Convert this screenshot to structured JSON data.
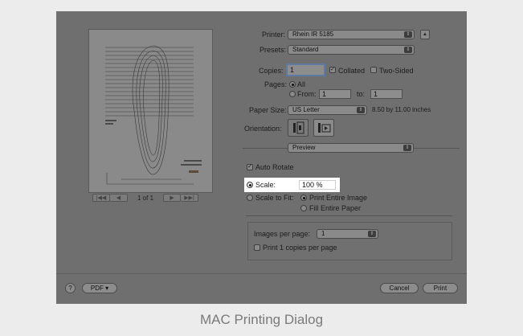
{
  "caption": "MAC Printing Dialog",
  "preview": {
    "pager_text": "1 of 1",
    "first_glyph": "|◀◀",
    "prev_glyph": "◀",
    "next_glyph": "▶",
    "last_glyph": "▶▶|"
  },
  "printer": {
    "label": "Printer:",
    "value": "Rhein IR 5185",
    "up_glyph": "▲"
  },
  "presets": {
    "label": "Presets:",
    "value": "Standard"
  },
  "copies": {
    "label": "Copies:",
    "value": "1",
    "collated_label": "Collated",
    "two_sided_label": "Two-Sided",
    "check_glyph": "✓"
  },
  "pages": {
    "label": "Pages:",
    "all_label": "All",
    "from_label": "From:",
    "from_value": "1",
    "to_label": "to:",
    "to_value": "1"
  },
  "paper_size": {
    "label": "Paper Size:",
    "value": "US Letter",
    "dims": "8.50 by 11.00 inches"
  },
  "orientation": {
    "label": "Orientation:"
  },
  "section": {
    "value": "Preview"
  },
  "auto_rotate": {
    "label": "Auto Rotate"
  },
  "scale": {
    "label": "Scale:",
    "value": "100 %"
  },
  "scale_to_fit": {
    "label": "Scale to Fit:",
    "print_entire": "Print Entire Image",
    "fill_entire": "Fill Entire Paper"
  },
  "images_per_page": {
    "label": "Images per page:",
    "value": "1",
    "print_copies_label": "Print 1 copies per page"
  },
  "buttons": {
    "help": "?",
    "pdf": "PDF ▾",
    "cancel": "Cancel",
    "print": "Print"
  },
  "popup_arrows": "⇕"
}
